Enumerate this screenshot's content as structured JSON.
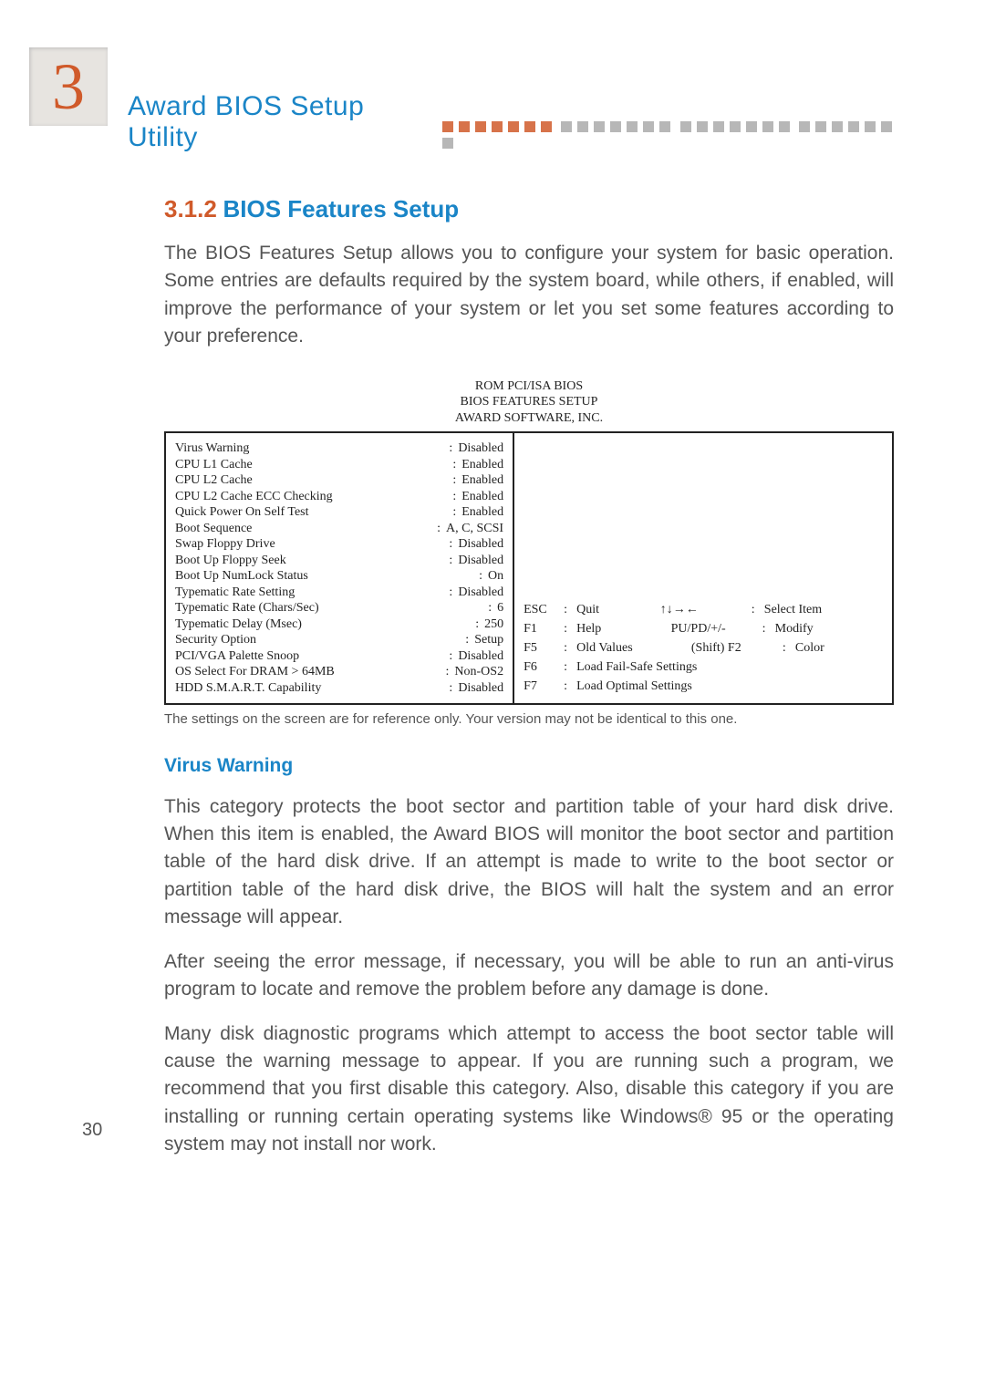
{
  "chapter": {
    "number": "3",
    "title": "Award BIOS Setup Utility"
  },
  "section": {
    "number": "3.1.2",
    "title": "BIOS Features Setup"
  },
  "intro": "The BIOS Features Setup allows you to configure your system for basic operation. Some entries are defaults required by the system board, while others, if enabled, will improve the performance of your system or let you set some features according to your preference.",
  "bios": {
    "heading_l1": "ROM PCI/ISA BIOS",
    "heading_l2": "BIOS FEATURES SETUP",
    "heading_l3": "AWARD SOFTWARE, INC.",
    "settings": [
      {
        "label": "Virus Warning",
        "value": "Disabled"
      },
      {
        "label": "CPU L1 Cache",
        "value": "Enabled"
      },
      {
        "label": "CPU L2 Cache",
        "value": "Enabled"
      },
      {
        "label": "CPU L2 Cache ECC Checking",
        "value": "Enabled"
      },
      {
        "label": "Quick Power On Self Test",
        "value": "Enabled"
      },
      {
        "label": "Boot Sequence",
        "value": "A, C, SCSI"
      },
      {
        "label": "Swap Floppy Drive",
        "value": "Disabled"
      },
      {
        "label": "Boot Up Floppy Seek",
        "value": "Disabled"
      },
      {
        "label": "Boot Up NumLock Status",
        "value": "On"
      },
      {
        "label": "Typematic Rate Setting",
        "value": "Disabled"
      },
      {
        "label": "Typematic Rate (Chars/Sec)",
        "value": "6"
      },
      {
        "label": "Typematic Delay (Msec)",
        "value": "250"
      },
      {
        "label": "Security Option",
        "value": "Setup"
      },
      {
        "label": "PCI/VGA Palette Snoop",
        "value": "Disabled"
      },
      {
        "label": "OS Select For DRAM > 64MB",
        "value": "Non-OS2"
      },
      {
        "label": "HDD S.M.A.R.T. Capability",
        "value": "Disabled"
      }
    ],
    "nav_left": [
      {
        "k": "ESC",
        "d": "Quit"
      },
      {
        "k": "F1",
        "d": "Help"
      },
      {
        "k": "F5",
        "d": "Old Values"
      },
      {
        "k": "F6",
        "d": "Load Fail-Safe Settings"
      },
      {
        "k": "F7",
        "d": "Load Optimal Settings"
      }
    ],
    "nav_right": [
      {
        "k": "↑↓→←",
        "d": "Select Item"
      },
      {
        "k": "PU/PD/+/-",
        "d": "Modify"
      },
      {
        "k": "(Shift) F2",
        "d": "Color"
      }
    ]
  },
  "footnote": "The settings on the screen are for reference only. Your version may not be identical to this one.",
  "sub1": {
    "title": "Virus Warning"
  },
  "p1": "This category protects the boot sector and partition table of your hard disk drive. When this item is enabled, the Award BIOS will monitor the boot sector and partition table of the hard disk drive. If an attempt is made to write to the boot sector or partition table of the hard disk drive, the BIOS will halt the system and an error message will appear.",
  "p2": "After seeing the error message, if necessary, you will be able to run an anti-virus program to locate and remove the problem before any damage is done.",
  "p3": "Many disk diagnostic programs which attempt to access the boot sector table will cause the warning message to appear. If you are running such a program, we recommend that you first disable this category. Also, disable this category if you are installing or running certain operating systems like Windows® 95 or the operating system may not install nor work.",
  "pagenum": "30"
}
